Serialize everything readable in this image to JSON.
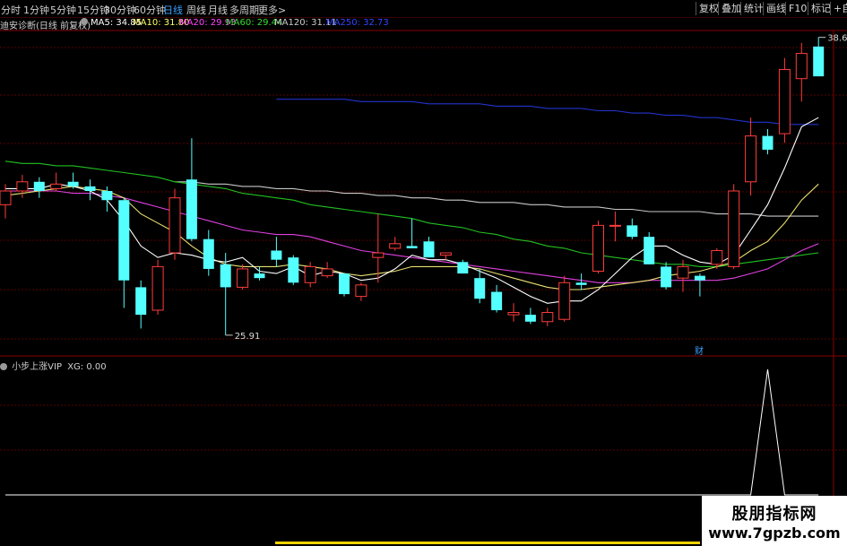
{
  "toolbar": {
    "periods": [
      "分时",
      "1分钟",
      "5分钟",
      "15分钟",
      "30分钟",
      "60分钟",
      "日线",
      "周线",
      "月线",
      "多周期",
      "更多>"
    ],
    "active_period": "日线",
    "right_buttons": [
      "复权",
      "叠加",
      "统计",
      "画线",
      "F10",
      "标记",
      "+自"
    ]
  },
  "main_legend": {
    "title": "迪安诊断(日线 前复权)",
    "ma": [
      {
        "label": "MA5: 34.85",
        "color": "#ffffff"
      },
      {
        "label": "MA10: 31.80",
        "color": "#ffff66"
      },
      {
        "label": "MA20: 29.93",
        "color": "#ff44ff"
      },
      {
        "label": "MA60: 29.44",
        "color": "#33dd33"
      },
      {
        "label": "MA120: 31.11",
        "color": "#cccccc"
      },
      {
        "label": "MA250: 32.73",
        "color": "#3344ff"
      }
    ]
  },
  "annotations": {
    "high_label": "38.66",
    "low_label": "25.91",
    "event_marker": "财"
  },
  "sub_legend": {
    "title": "小步上涨VIP",
    "value": "XG: 0.00"
  },
  "watermark": {
    "title": "股朋指标网",
    "url": "www.7gpzb.com"
  },
  "colors": {
    "up": "#ff3c3c",
    "down": "#54ffff",
    "grid": "#5a0000",
    "ma250": "#2233cc"
  },
  "chart_data": {
    "type": "candlestick",
    "candles": [
      [
        31.6,
        32.5,
        31.0,
        32.2
      ],
      [
        32.2,
        32.9,
        31.9,
        32.6
      ],
      [
        32.6,
        32.8,
        31.9,
        32.2
      ],
      [
        32.3,
        33.0,
        32.2,
        32.5
      ],
      [
        32.6,
        33.0,
        32.3,
        32.4
      ],
      [
        32.4,
        32.7,
        31.8,
        32.2
      ],
      [
        32.2,
        32.4,
        31.3,
        31.8
      ],
      [
        31.8,
        31.9,
        27.1,
        28.3
      ],
      [
        28.0,
        28.3,
        26.2,
        26.8
      ],
      [
        27.0,
        29.2,
        26.8,
        28.9
      ],
      [
        29.5,
        32.3,
        29.2,
        31.9
      ],
      [
        32.7,
        34.5,
        30.0,
        30.1
      ],
      [
        30.1,
        30.5,
        28.5,
        28.8
      ],
      [
        29.0,
        29.5,
        25.91,
        28.0
      ],
      [
        28.0,
        29.0,
        27.9,
        28.8
      ],
      [
        28.6,
        28.9,
        28.3,
        28.4
      ],
      [
        29.6,
        30.2,
        28.9,
        29.2
      ],
      [
        29.3,
        29.4,
        28.1,
        28.2
      ],
      [
        28.2,
        29.1,
        28.0,
        28.9
      ],
      [
        28.5,
        29.1,
        28.4,
        28.8
      ],
      [
        28.6,
        28.6,
        27.6,
        27.7
      ],
      [
        27.6,
        28.2,
        27.4,
        28.1
      ],
      [
        29.3,
        31.2,
        28.2,
        29.5
      ],
      [
        29.7,
        30.2,
        29.6,
        29.9
      ],
      [
        29.8,
        31.0,
        29.7,
        29.7
      ],
      [
        30.0,
        30.2,
        29.3,
        29.3
      ],
      [
        29.4,
        29.5,
        29.2,
        29.5
      ],
      [
        29.1,
        29.2,
        28.6,
        28.6
      ],
      [
        28.4,
        28.8,
        27.3,
        27.5
      ],
      [
        27.8,
        28.1,
        26.9,
        27.0
      ],
      [
        26.8,
        27.3,
        26.5,
        26.9
      ],
      [
        26.8,
        27.1,
        26.4,
        26.5
      ],
      [
        26.5,
        27.1,
        26.3,
        26.9
      ],
      [
        26.6,
        28.5,
        26.5,
        28.2
      ],
      [
        28.2,
        28.6,
        27.9,
        28.1
      ],
      [
        28.7,
        30.9,
        28.6,
        30.7
      ],
      [
        30.7,
        31.3,
        30.0,
        30.7
      ],
      [
        30.7,
        31.0,
        30.1,
        30.2
      ],
      [
        30.2,
        30.4,
        29.0,
        29.0
      ],
      [
        28.9,
        29.1,
        27.9,
        28.0
      ],
      [
        28.4,
        29.2,
        27.8,
        28.9
      ],
      [
        28.5,
        28.6,
        27.6,
        28.3
      ],
      [
        29.0,
        29.7,
        28.8,
        29.6
      ],
      [
        28.9,
        32.5,
        28.8,
        32.2
      ],
      [
        32.6,
        35.4,
        32.0,
        34.6
      ],
      [
        34.6,
        34.9,
        33.8,
        34.0
      ],
      [
        34.7,
        38.0,
        34.3,
        37.5
      ],
      [
        37.1,
        38.66,
        36.1,
        38.2
      ],
      [
        38.5,
        38.9,
        37.2,
        37.2
      ]
    ],
    "ma5": [
      32.3,
      32.3,
      32.3,
      32.5,
      32.4,
      32.2,
      31.8,
      30.9,
      29.8,
      29.3,
      29.5,
      29.4,
      29.2,
      29.1,
      29.3,
      28.7,
      28.6,
      28.9,
      28.5,
      28.7,
      28.6,
      28.3,
      28.4,
      28.8,
      29.4,
      29.2,
      29.2,
      29.0,
      28.7,
      28.4,
      28.0,
      27.6,
      27.3,
      27.4,
      27.4,
      27.9,
      28.6,
      29.3,
      29.8,
      29.8,
      29.4,
      29.1,
      29.0,
      29.4,
      30.5,
      31.6,
      33.2,
      35.0,
      35.4
    ],
    "ma10": [
      32.0,
      32.1,
      32.2,
      32.3,
      32.4,
      32.3,
      32.2,
      31.9,
      31.2,
      30.8,
      30.4,
      29.8,
      29.3,
      29.0,
      28.9,
      28.9,
      28.9,
      29.0,
      28.9,
      28.8,
      28.6,
      28.5,
      28.6,
      28.7,
      28.9,
      28.9,
      28.9,
      28.9,
      28.8,
      28.6,
      28.4,
      28.2,
      28.0,
      27.9,
      27.9,
      28.0,
      28.1,
      28.2,
      28.3,
      28.5,
      28.6,
      28.7,
      28.9,
      29.1,
      29.6,
      30.0,
      30.8,
      31.8,
      32.5
    ],
    "ma20": [
      32.2,
      32.2,
      32.2,
      32.2,
      32.1,
      32.1,
      32.0,
      31.9,
      31.7,
      31.5,
      31.3,
      31.1,
      30.9,
      30.7,
      30.5,
      30.4,
      30.3,
      30.3,
      30.2,
      30.0,
      29.8,
      29.6,
      29.5,
      29.4,
      29.3,
      29.2,
      29.1,
      29.0,
      28.9,
      28.8,
      28.7,
      28.6,
      28.5,
      28.4,
      28.3,
      28.2,
      28.2,
      28.2,
      28.3,
      28.3,
      28.3,
      28.3,
      28.3,
      28.4,
      28.6,
      28.8,
      29.2,
      29.6,
      29.9
    ],
    "ma60": [
      33.5,
      33.4,
      33.4,
      33.3,
      33.3,
      33.2,
      33.1,
      33.0,
      32.9,
      32.8,
      32.6,
      32.5,
      32.4,
      32.3,
      32.1,
      32.0,
      31.9,
      31.8,
      31.6,
      31.5,
      31.4,
      31.3,
      31.2,
      31.1,
      31.0,
      30.8,
      30.7,
      30.6,
      30.4,
      30.3,
      30.1,
      30.0,
      29.8,
      29.7,
      29.5,
      29.4,
      29.3,
      29.2,
      29.1,
      29.0,
      29.0,
      28.9,
      28.9,
      29.0,
      29.1,
      29.2,
      29.3,
      29.4,
      29.5
    ],
    "ma120": [
      null,
      null,
      null,
      null,
      null,
      null,
      null,
      null,
      null,
      null,
      32.6,
      32.6,
      32.5,
      32.5,
      32.4,
      32.4,
      32.3,
      32.3,
      32.2,
      32.2,
      32.1,
      32.1,
      32.0,
      32.0,
      31.9,
      31.9,
      31.8,
      31.8,
      31.7,
      31.7,
      31.7,
      31.6,
      31.6,
      31.5,
      31.5,
      31.5,
      31.4,
      31.4,
      31.3,
      31.3,
      31.3,
      31.3,
      31.2,
      31.2,
      31.2,
      31.1,
      31.1,
      31.1,
      31.1
    ],
    "ma250": [
      null,
      null,
      null,
      null,
      null,
      null,
      null,
      null,
      null,
      null,
      null,
      null,
      null,
      null,
      null,
      null,
      36.2,
      36.2,
      36.2,
      36.2,
      36.2,
      36.1,
      36.1,
      36.1,
      36.1,
      36.0,
      36.0,
      36.0,
      36.0,
      35.9,
      35.9,
      35.9,
      35.8,
      35.8,
      35.8,
      35.7,
      35.7,
      35.6,
      35.6,
      35.5,
      35.5,
      35.4,
      35.4,
      35.3,
      35.2,
      35.2,
      35.1,
      35.1,
      35.1
    ],
    "xg": [
      0,
      0,
      0,
      0,
      0,
      0,
      0,
      0,
      0,
      0,
      0,
      0,
      0,
      0,
      0,
      0,
      0,
      0,
      0,
      0,
      0,
      0,
      0,
      0,
      0,
      0,
      0,
      0,
      0,
      0,
      0,
      0,
      0,
      0,
      0,
      0,
      0,
      0,
      0,
      0,
      0,
      0,
      0,
      0,
      0,
      1,
      0,
      0,
      0
    ]
  }
}
